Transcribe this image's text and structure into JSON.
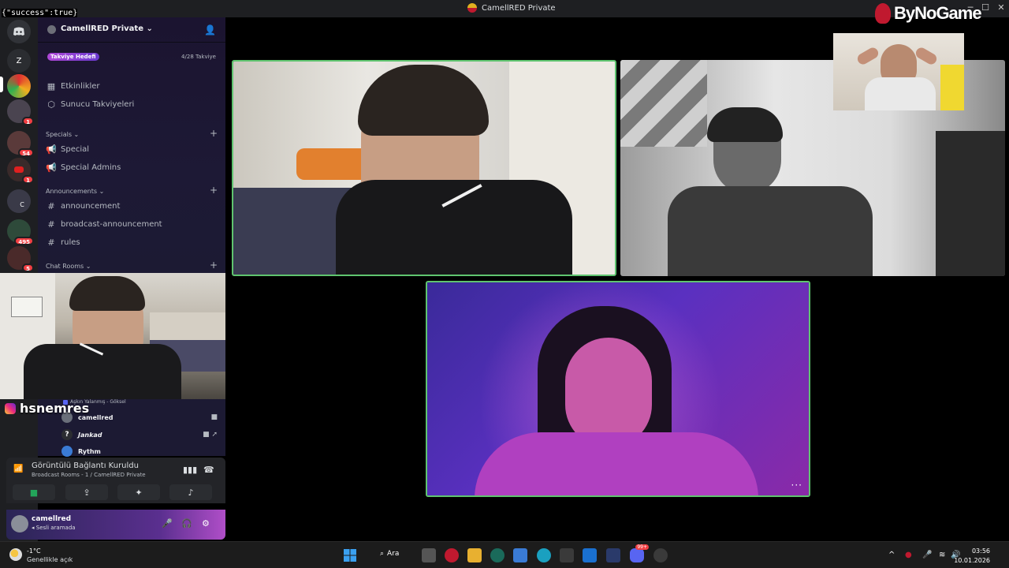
{
  "response_text": "{\"success\":true}",
  "window": {
    "title": "CamellRED Private"
  },
  "watermark": {
    "brand": "ByNoGame"
  },
  "rail": {
    "letter_server": "Z",
    "badges": [
      "1",
      "54",
      "1",
      "495",
      "5"
    ],
    "server_letter_c": "C"
  },
  "server": {
    "name": "CamellRED Private",
    "boost_goal_label": "Takviye Hedefi",
    "boost_count": "4/28 Takviye"
  },
  "nav": {
    "events": "Etkinlikler",
    "server_boosts": "Sunucu Takviyeleri"
  },
  "categories": {
    "specials": "Specials",
    "announcements": "Announcements",
    "chat_rooms": "Chat Rooms"
  },
  "channels": {
    "special": "Special",
    "special_admins": "Special Admins",
    "announcement": "announcement",
    "broadcast_announcement": "broadcast-announcement",
    "rules": "rules"
  },
  "voice": {
    "song_label": "Aşkın Yalanmış - Göksel",
    "overlay_name": "hsnemres",
    "users": [
      "camellred",
      "Jankad",
      "Rythm"
    ]
  },
  "voice_panel": {
    "status": "Görüntülü Bağlantı Kuruldu",
    "channel": "Broadcast Rooms - 1 / CamellRED Private"
  },
  "user_panel": {
    "username": "camellred",
    "status": "Sesli aramada"
  },
  "taskbar": {
    "temperature": "-1°C",
    "weather": "Genellikle açık",
    "search": "Ara",
    "time": "03:56",
    "date": "10.01.2026",
    "discord_badge": "99+"
  },
  "colors": {
    "speaking_border": "#5fc46f",
    "boost_gradient_start": "#b048d8",
    "connected_green": "#23a55a",
    "mention_red": "#f23f43"
  }
}
